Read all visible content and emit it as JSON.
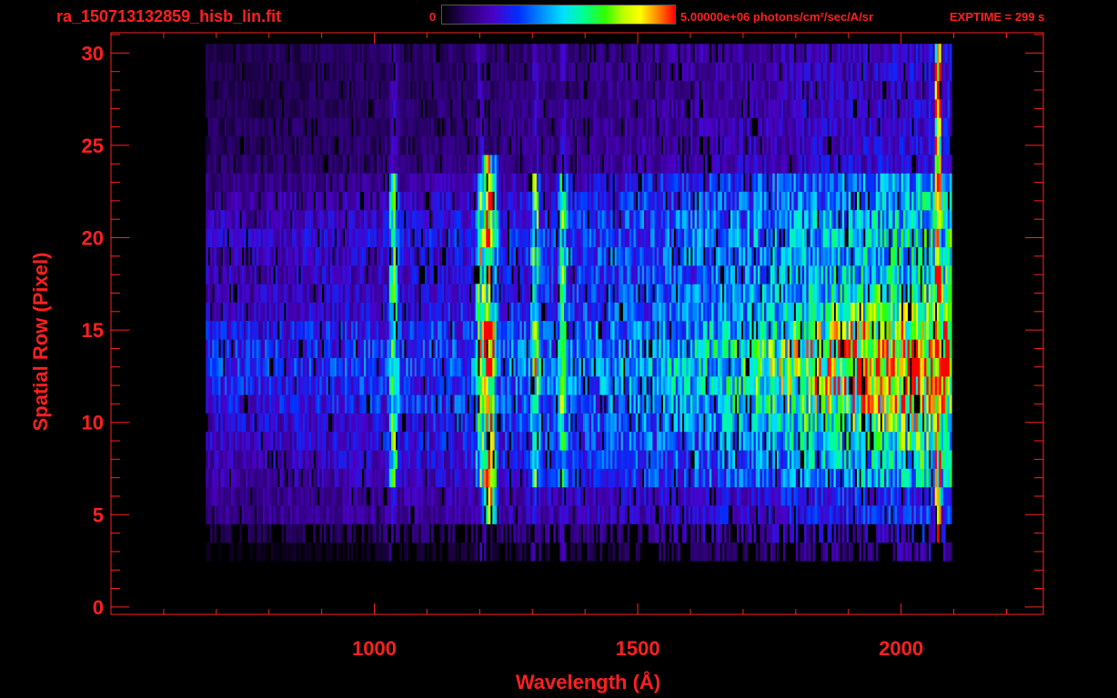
{
  "header": {
    "filename": "ra_150713132859_hisb_lin.fit",
    "colorbar_min": "0",
    "colorbar_max_label": "5.00000e+06 photons/cm²/sec/A/sr",
    "exptime": "EXPTIME = 299 s"
  },
  "colors": {
    "axis": "#ff2020",
    "background": "#000000"
  },
  "chart_data": {
    "type": "heatmap",
    "title": "",
    "xlabel": "Wavelength (Å)",
    "ylabel": "Spatial Row (Pixel)",
    "xlim": [
      500,
      2270
    ],
    "ylim": [
      -0.4,
      31.1
    ],
    "xticks": [
      1000,
      1500,
      2000
    ],
    "yticks": [
      0,
      5,
      10,
      15,
      20,
      25,
      30
    ],
    "colorscale": "rainbow",
    "zlim": [
      0,
      5000000
    ],
    "detector_extent_x": [
      680,
      2080
    ],
    "illuminated_rows": [
      4,
      30
    ],
    "slit_rows": [
      7,
      23
    ],
    "emission_lines": [
      {
        "wavelength": 1216,
        "peak_fraction": 0.97
      },
      {
        "wavelength": 1035,
        "peak_fraction": 0.55
      },
      {
        "wavelength": 1304,
        "peak_fraction": 0.55
      },
      {
        "wavelength": 1356,
        "peak_fraction": 0.5
      },
      {
        "wavelength": 1200,
        "peak_fraction": 0.55
      }
    ],
    "continuum_peak": {
      "wavelength": 2010,
      "row": 13,
      "fraction": 0.85
    },
    "detector_edge": {
      "wavelength": 2068,
      "fraction": 0.92
    },
    "row_profile": [
      {
        "row": 3,
        "fraction": 0.05
      },
      {
        "row": 4,
        "fraction": 0.18
      },
      {
        "row": 5,
        "fraction": 0.28
      },
      {
        "row": 6,
        "fraction": 0.3
      },
      {
        "row": 7,
        "fraction": 0.33
      },
      {
        "row": 8,
        "fraction": 0.38
      },
      {
        "row": 9,
        "fraction": 0.42
      },
      {
        "row": 10,
        "fraction": 0.45
      },
      {
        "row": 11,
        "fraction": 0.5
      },
      {
        "row": 12,
        "fraction": 0.55
      },
      {
        "row": 13,
        "fraction": 0.58
      },
      {
        "row": 14,
        "fraction": 0.56
      },
      {
        "row": 15,
        "fraction": 0.5
      },
      {
        "row": 16,
        "fraction": 0.42
      },
      {
        "row": 17,
        "fraction": 0.38
      },
      {
        "row": 18,
        "fraction": 0.38
      },
      {
        "row": 19,
        "fraction": 0.4
      },
      {
        "row": 20,
        "fraction": 0.42
      },
      {
        "row": 21,
        "fraction": 0.38
      },
      {
        "row": 22,
        "fraction": 0.33
      },
      {
        "row": 23,
        "fraction": 0.25
      },
      {
        "row": 24,
        "fraction": 0.2
      },
      {
        "row": 25,
        "fraction": 0.18
      },
      {
        "row": 26,
        "fraction": 0.17
      },
      {
        "row": 27,
        "fraction": 0.16
      },
      {
        "row": 28,
        "fraction": 0.15
      },
      {
        "row": 29,
        "fraction": 0.15
      },
      {
        "row": 30,
        "fraction": 0.15
      }
    ]
  }
}
